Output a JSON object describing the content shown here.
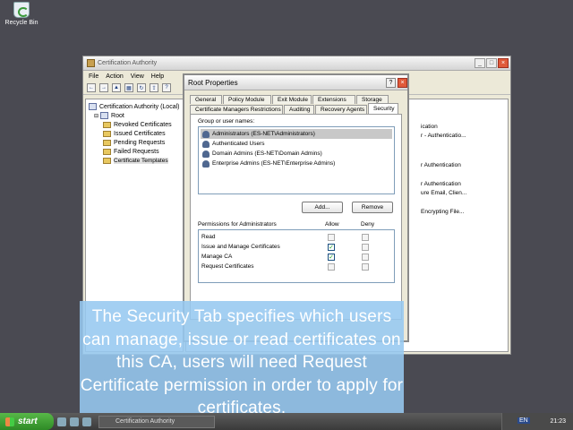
{
  "desktop": {
    "recycle_bin": "Recycle Bin"
  },
  "mmc": {
    "title": "Certification Authority",
    "menu": [
      "File",
      "Action",
      "View",
      "Help"
    ],
    "tree": {
      "root": "Certification Authority (Local)",
      "ca": "Root",
      "folders": [
        "Revoked Certificates",
        "Issued Certificates",
        "Pending Requests",
        "Failed Requests",
        "Certificate Templates"
      ]
    },
    "right_fragments": [
      "ication",
      "r - Authenticatio...",
      "r Authentication",
      "r Authentication",
      "ure Email, Clien...",
      "Encrypting File..."
    ]
  },
  "dialog": {
    "title": "Root Properties",
    "help_btn": "?",
    "close_btn": "×",
    "tabs_row1": [
      "General",
      "Policy Module",
      "Exit Module",
      "Extensions",
      "Storage"
    ],
    "tabs_row2": [
      "Certificate Managers Restrictions",
      "Auditing",
      "Recovery Agents",
      "Security"
    ],
    "group_label": "Group or user names:",
    "users": [
      "Administrators (ES-NET\\Administrators)",
      "Authenticated Users",
      "Domain Admins (ES-NET\\Domain Admins)",
      "Enterprise Admins (ES-NET\\Enterprise Admins)"
    ],
    "add_button": "Add...",
    "remove_button": "Remove",
    "perm_label": "Permissions for Administrators",
    "allow_header": "Allow",
    "deny_header": "Deny",
    "permissions": [
      {
        "name": "Read",
        "allow": false,
        "deny": false
      },
      {
        "name": "Issue and Manage Certificates",
        "allow": true,
        "deny": false
      },
      {
        "name": "Manage CA",
        "allow": true,
        "deny": false
      },
      {
        "name": "Request Certificates",
        "allow": false,
        "deny": false
      }
    ]
  },
  "caption": "The Security Tab specifies which users can manage, issue or read certificates on this CA, users will need Request Certificate permission in order to apply for certificates.",
  "taskbar": {
    "start": "start",
    "task": "Certification Authority",
    "lang": "EN",
    "clock": "21:23"
  }
}
